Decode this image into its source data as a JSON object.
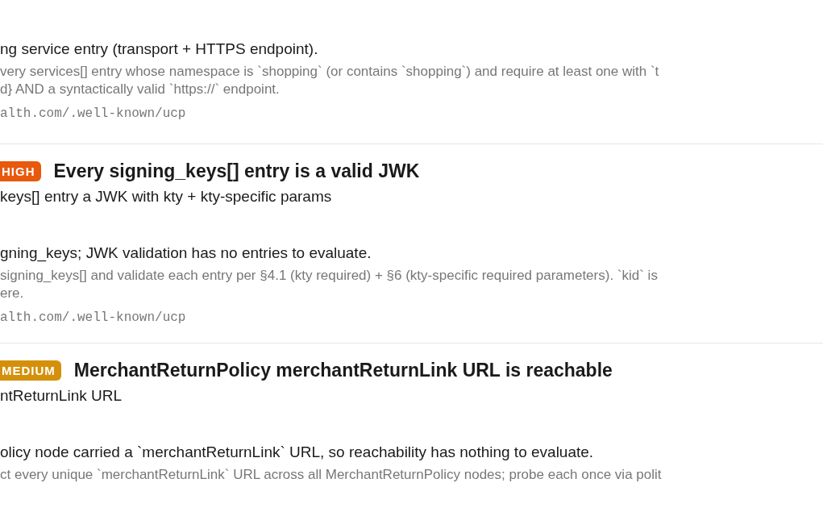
{
  "checks": [
    {
      "finding": "ng service entry (transport + HTTPS endpoint).",
      "method_lines": [
        "very services[] entry whose namespace is `shopping` (or contains `shopping`) and require at least one with `t",
        "d} AND a syntactically valid `https://` endpoint."
      ],
      "url": "alth.com/.well-known/ucp"
    },
    {
      "severity": {
        "label": "HIGH",
        "kind": "high"
      },
      "title": "Every signing_keys[] entry is a valid JWK",
      "subtitle": "keys[] entry a JWK with kty + kty-specific params",
      "finding": "gning_keys; JWK validation has no entries to evaluate.",
      "method_lines": [
        "signing_keys[] and validate each entry per §4.1 (kty required) + §6 (kty-specific required parameters). `kid` is",
        "ere."
      ],
      "url": "alth.com/.well-known/ucp"
    },
    {
      "severity": {
        "label": "MEDIUM",
        "kind": "medium"
      },
      "title": "MerchantReturnPolicy merchantReturnLink URL is reachable",
      "subtitle": "ntReturnLink URL",
      "finding": "olicy node carried a `merchantReturnLink` URL, so reachability has nothing to evaluate.",
      "method_lines": [
        "ct every unique `merchantReturnLink` URL across all MerchantReturnPolicy nodes; probe each once via polit"
      ]
    }
  ]
}
